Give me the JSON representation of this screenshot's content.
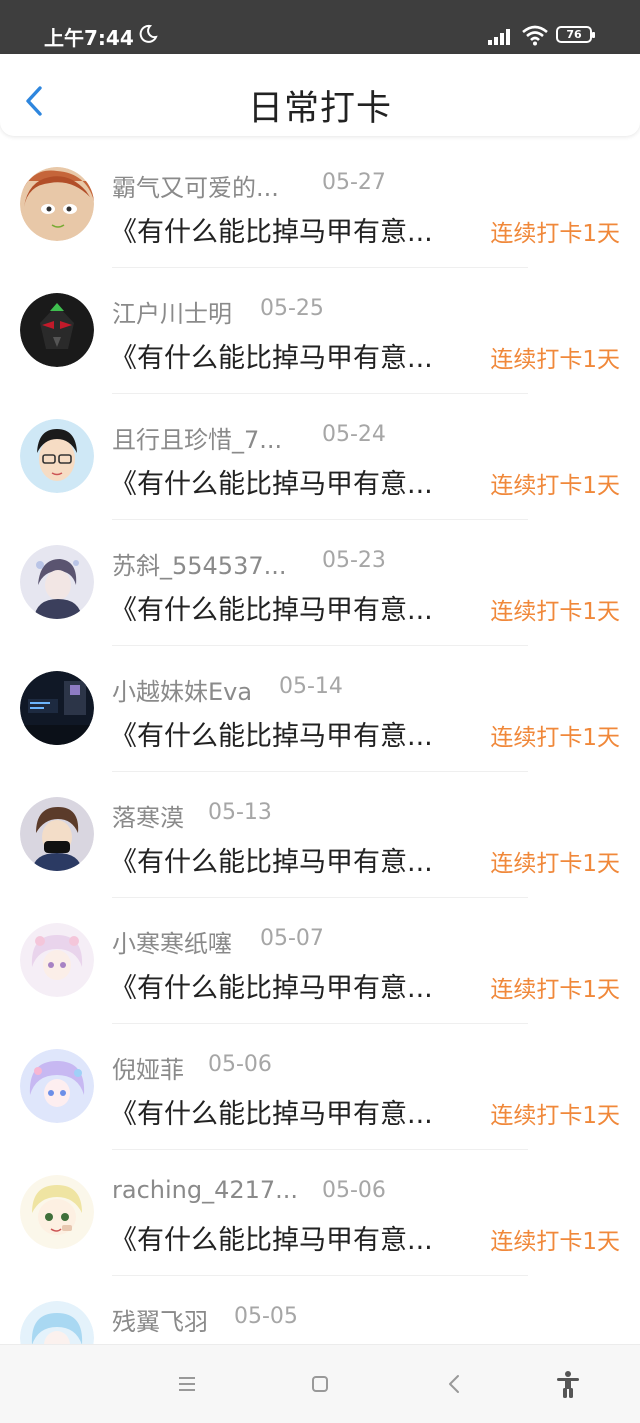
{
  "status_bar": {
    "time": "上午7:44",
    "battery": "76",
    "icons": [
      "moon-icon",
      "signal-icon",
      "wifi-icon",
      "battery-icon"
    ]
  },
  "header": {
    "title": "日常打卡",
    "back_icon": "chevron-left-icon"
  },
  "colors": {
    "accent_blue": "#2e86de",
    "streak_orange": "#f0883a",
    "status_bar_bg": "#3e3e3e"
  },
  "list": {
    "items": [
      {
        "name": "霸气又可爱的...",
        "date": "05-27",
        "title": "《有什么能比掉马甲有意...",
        "streak": "连续打卡1天"
      },
      {
        "name": "江户川士明",
        "date": "05-25",
        "title": "《有什么能比掉马甲有意...",
        "streak": "连续打卡1天"
      },
      {
        "name": "且行且珍惜_7...",
        "date": "05-24",
        "title": "《有什么能比掉马甲有意...",
        "streak": "连续打卡1天"
      },
      {
        "name": "苏斜_554537...",
        "date": "05-23",
        "title": "《有什么能比掉马甲有意...",
        "streak": "连续打卡1天"
      },
      {
        "name": "小越妹妹Eva",
        "date": "05-14",
        "title": "《有什么能比掉马甲有意...",
        "streak": "连续打卡1天"
      },
      {
        "name": "落寒漠",
        "date": "05-13",
        "title": "《有什么能比掉马甲有意...",
        "streak": "连续打卡1天"
      },
      {
        "name": "小寒寒纸噻",
        "date": "05-07",
        "title": "《有什么能比掉马甲有意...",
        "streak": "连续打卡1天"
      },
      {
        "name": "倪娅菲",
        "date": "05-06",
        "title": "《有什么能比掉马甲有意...",
        "streak": "连续打卡1天"
      },
      {
        "name": "raching_4217...",
        "date": "05-06",
        "title": "《有什么能比掉马甲有意...",
        "streak": "连续打卡1天"
      },
      {
        "name": "残翼飞羽",
        "date": "05-05",
        "title": "",
        "streak": ""
      }
    ]
  },
  "nav_bar": {
    "icons": [
      "menu-icon",
      "home-square-icon",
      "back-triangle-icon",
      "accessibility-icon"
    ]
  }
}
